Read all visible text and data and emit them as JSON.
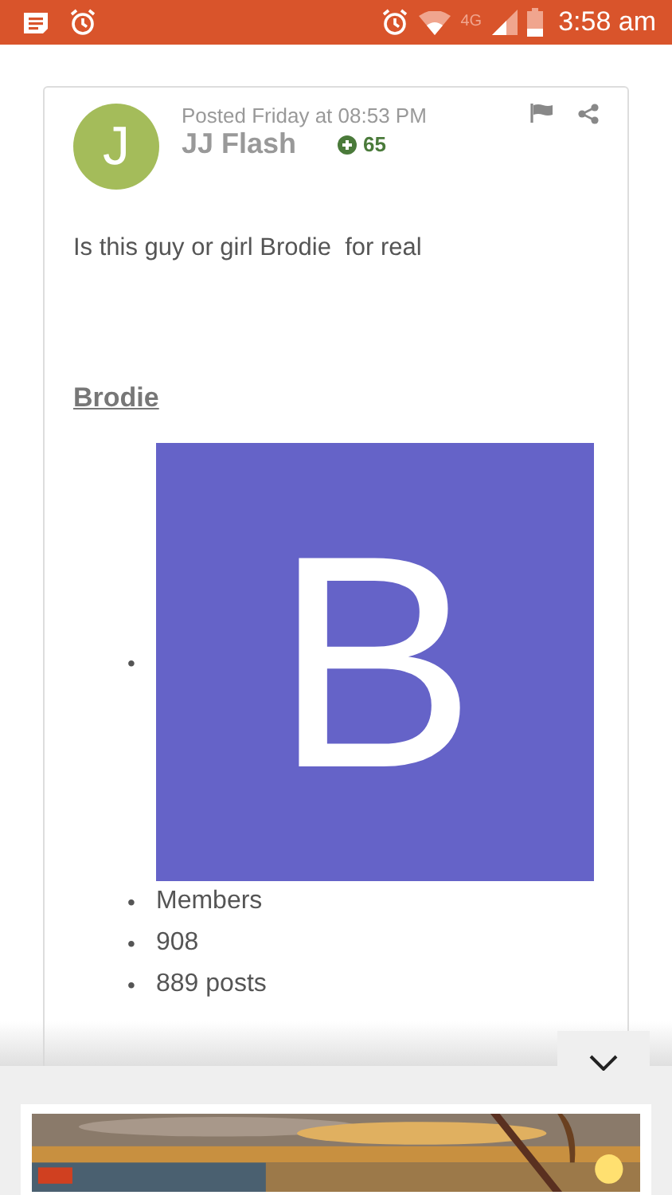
{
  "status_bar": {
    "network": "4G",
    "time": "3:58 am"
  },
  "post": {
    "avatar_letter": "J",
    "posted": "Posted Friday at 08:53 PM",
    "author": "JJ Flash",
    "reputation": "65",
    "body": "Is this guy or girl Brodie  for real",
    "mention": "Brodie",
    "profile": {
      "avatar": {
        "bullet": "•",
        "letter": "B"
      },
      "details": [
        {
          "bullet": "•",
          "text": "Members"
        },
        {
          "bullet": "•",
          "text": "908"
        },
        {
          "bullet": "•",
          "text": "889 posts"
        }
      ]
    }
  }
}
